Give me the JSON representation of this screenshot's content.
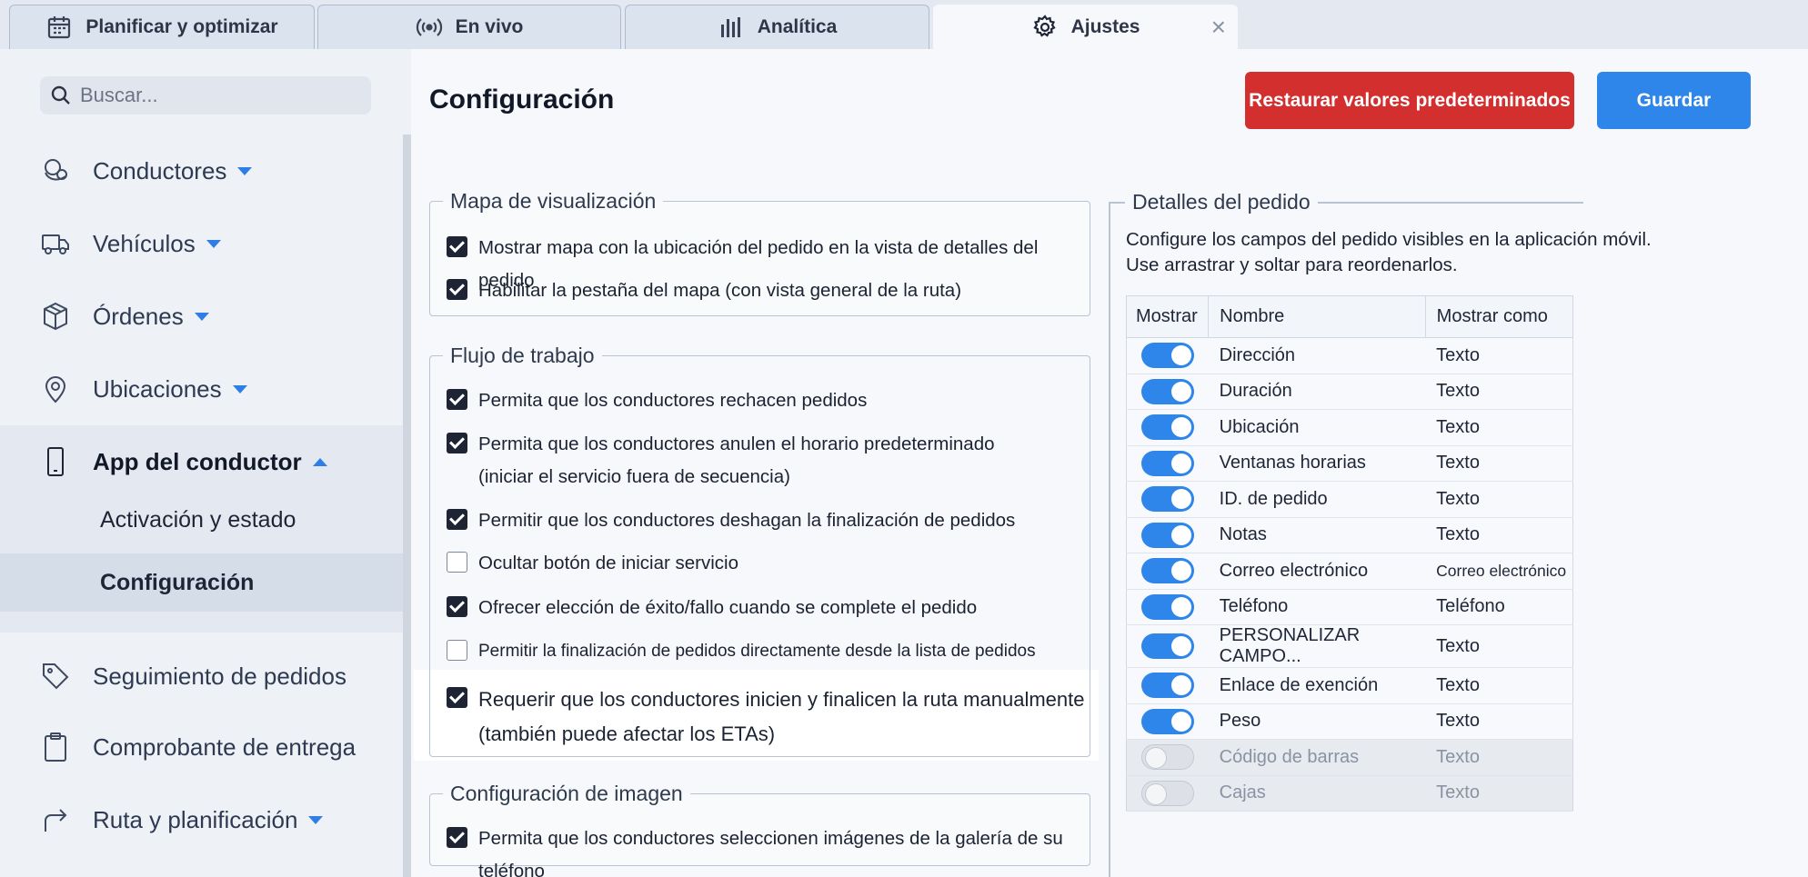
{
  "tabs": [
    {
      "label": "Planificar y optimizar",
      "icon": "calendar-icon"
    },
    {
      "label": "En vivo",
      "icon": "broadcast-icon"
    },
    {
      "label": "Analítica",
      "icon": "bar-chart-icon"
    },
    {
      "label": "Ajustes",
      "icon": "gear-icon",
      "active": true
    }
  ],
  "sidebar": {
    "search_placeholder": "Buscar...",
    "items": [
      {
        "label": "Conductores",
        "icon": "drivers-icon"
      },
      {
        "label": "Vehículos",
        "icon": "truck-icon"
      },
      {
        "label": "Órdenes",
        "icon": "package-icon"
      },
      {
        "label": "Ubicaciones",
        "icon": "map-pin-icon"
      },
      {
        "label": "App del conductor",
        "icon": "phone-icon",
        "expanded": true
      },
      {
        "label": "Seguimiento de pedidos",
        "icon": "tag-icon"
      },
      {
        "label": "Comprobante de entrega",
        "icon": "clipboard-icon"
      },
      {
        "label": "Ruta y planificación",
        "icon": "route-arrow-icon"
      }
    ],
    "subitems": [
      "Activación y estado",
      "Configuración"
    ]
  },
  "main": {
    "title": "Configuración",
    "restore_label": "Restaurar valores predeterminados",
    "save_label": "Guardar"
  },
  "map_section": {
    "legend": "Mapa de visualización",
    "options": [
      {
        "label": "Mostrar mapa con la ubicación del pedido en la vista de detalles del pedido",
        "checked": true
      },
      {
        "label": "Habilitar la pestaña del mapa (con vista general de la ruta)",
        "checked": true
      }
    ]
  },
  "workflow_section": {
    "legend": "Flujo de trabajo",
    "options": [
      {
        "line1": "Permita que los conductores rechacen pedidos",
        "checked": true
      },
      {
        "line1": "Permita que los conductores anulen el horario predeterminado",
        "line2": "(iniciar el servicio fuera de secuencia)",
        "checked": true
      },
      {
        "line1": "Permitir que los conductores deshagan la finalización de pedidos",
        "checked": true
      },
      {
        "line1": "Ocultar botón de iniciar servicio",
        "checked": false
      },
      {
        "line1": "Ofrecer elección de éxito/fallo cuando se complete el pedido",
        "checked": true
      },
      {
        "line1": "Permitir la finalización de pedidos directamente desde la lista de pedidos",
        "checked": false
      },
      {
        "line1": "Requerir que los conductores inicien y finalicen la ruta manualmente",
        "line2": "(también puede afectar los ETAs)",
        "checked": true
      }
    ]
  },
  "image_section": {
    "legend": "Configuración de imagen",
    "options": [
      {
        "label": "Permita que los conductores seleccionen imágenes de la galería de su teléfono",
        "checked": true
      }
    ]
  },
  "order_details": {
    "legend": "Detalles del pedido",
    "desc_line1": "Configure los campos del pedido visibles en la aplicación móvil.",
    "desc_line2": "Use arrastrar y soltar para reordenarlos.",
    "columns": [
      "Mostrar",
      "Nombre",
      "Mostrar como"
    ],
    "rows": [
      {
        "name": "Dirección",
        "as": "Texto",
        "on": true
      },
      {
        "name": "Duración",
        "as": "Texto",
        "on": true
      },
      {
        "name": "Ubicación",
        "as": "Texto",
        "on": true
      },
      {
        "name": "Ventanas horarias",
        "as": "Texto",
        "on": true
      },
      {
        "name": "ID. de pedido",
        "as": "Texto",
        "on": true
      },
      {
        "name": "Notas",
        "as": "Texto",
        "on": true
      },
      {
        "name": "Correo electrónico",
        "as": "Correo electrónico",
        "on": true
      },
      {
        "name": "Teléfono",
        "as": "Teléfono",
        "on": true
      },
      {
        "name": "PERSONALIZAR CAMPO...",
        "as": "Texto",
        "on": true
      },
      {
        "name": "Enlace de exención",
        "as": "Texto",
        "on": true
      },
      {
        "name": "Peso",
        "as": "Texto",
        "on": true
      },
      {
        "name": "Código de barras",
        "as": "Texto",
        "on": false
      },
      {
        "name": "Cajas",
        "as": "Texto",
        "on": false
      }
    ]
  }
}
